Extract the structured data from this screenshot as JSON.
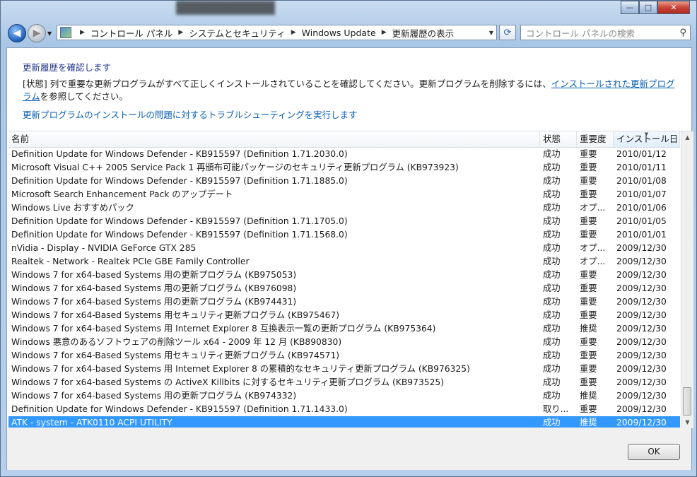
{
  "window": {
    "min_glyph": "—",
    "max_glyph": "□",
    "close_glyph": "✕"
  },
  "nav": {
    "breadcrumbs": [
      "コントロール パネル",
      "システムとセキュリティ",
      "Windows Update",
      "更新履歴の表示"
    ],
    "search_placeholder": "コントロール パネルの検索"
  },
  "page": {
    "heading": "更新履歴を確認します",
    "description_before": "[状態] 列で重要な更新プログラムがすべて正しくインストールされていることを確認してください。更新プログラムを削除するには、",
    "description_link": "インストールされた更新プログラム",
    "description_after": "を参照してください。",
    "troubleshoot_link": "更新プログラムのインストールの問題に対するトラブルシューティングを実行します"
  },
  "table": {
    "columns": [
      "名前",
      "状態",
      "重要度",
      "インストール日"
    ],
    "rows": [
      [
        "Definition Update for Windows Defender - KB915597 (Definition 1.71.2030.0)",
        "成功",
        "重要",
        "2010/01/12"
      ],
      [
        "Microsoft Visual C++ 2005 Service Pack 1 再頒布可能パッケージのセキュリティ更新プログラム (KB973923)",
        "成功",
        "重要",
        "2010/01/11"
      ],
      [
        "Definition Update for Windows Defender - KB915597 (Definition 1.71.1885.0)",
        "成功",
        "重要",
        "2010/01/08"
      ],
      [
        "Microsoft Search Enhancement Pack のアップデート",
        "成功",
        "重要",
        "2010/01/07"
      ],
      [
        "Windows Live おすすめパック",
        "成功",
        "オプ...",
        "2010/01/06"
      ],
      [
        "Definition Update for Windows Defender - KB915597 (Definition 1.71.1705.0)",
        "成功",
        "重要",
        "2010/01/05"
      ],
      [
        "Definition Update for Windows Defender - KB915597 (Definition 1.71.1568.0)",
        "成功",
        "重要",
        "2010/01/01"
      ],
      [
        "nVidia - Display - NVIDIA GeForce GTX 285",
        "成功",
        "オプ...",
        "2009/12/30"
      ],
      [
        "Realtek - Network - Realtek PCIe GBE Family Controller",
        "成功",
        "オプ...",
        "2009/12/30"
      ],
      [
        "Windows 7 for x64-based Systems 用の更新プログラム (KB975053)",
        "成功",
        "重要",
        "2009/12/30"
      ],
      [
        "Windows 7 for x64-based Systems 用の更新プログラム (KB976098)",
        "成功",
        "重要",
        "2009/12/30"
      ],
      [
        "Windows 7 for x64-based Systems 用の更新プログラム (KB974431)",
        "成功",
        "重要",
        "2009/12/30"
      ],
      [
        "Windows 7 for x64-Based Systems 用セキュリティ更新プログラム (KB975467)",
        "成功",
        "重要",
        "2009/12/30"
      ],
      [
        "Windows 7 for x64-based Systems 用 Internet Explorer 8 互換表示一覧の更新プログラム (KB975364)",
        "成功",
        "推奨",
        "2009/12/30"
      ],
      [
        "Windows 悪意のあるソフトウェアの削除ツール x64 - 2009 年 12 月 (KB890830)",
        "成功",
        "重要",
        "2009/12/30"
      ],
      [
        "Windows 7 for x64-Based Systems 用セキュリティ更新プログラム (KB974571)",
        "成功",
        "重要",
        "2009/12/30"
      ],
      [
        "Windows 7 for x64-based Systems 用 Internet Explorer 8 の累積的なセキュリティ更新プログラム (KB976325)",
        "成功",
        "重要",
        "2009/12/30"
      ],
      [
        "Windows 7 for x64-based Systems の ActiveX Killbits に対するセキュリティ更新プログラム (KB973525)",
        "成功",
        "重要",
        "2009/12/30"
      ],
      [
        "Windows 7 for x64-based Systems 用の更新プログラム (KB974332)",
        "成功",
        "推奨",
        "2009/12/30"
      ],
      [
        "Definition Update for Windows Defender - KB915597 (Definition 1.71.1433.0)",
        "取り...",
        "重要",
        "2009/12/30"
      ],
      [
        "ATK - system - ATK0110 ACPI UTILITY",
        "成功",
        "推奨",
        "2009/12/30"
      ]
    ],
    "selected_row": 20
  },
  "footer": {
    "ok_label": "OK"
  }
}
